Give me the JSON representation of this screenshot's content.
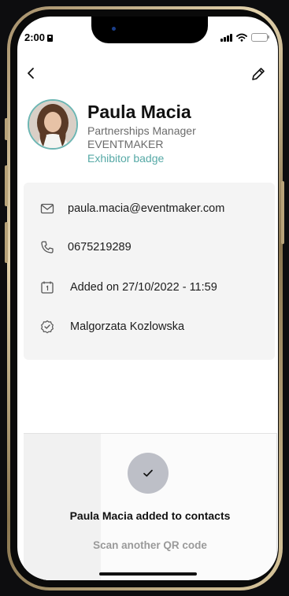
{
  "status": {
    "time": "2:00"
  },
  "header": {
    "back_icon": "chevron-left-icon",
    "edit_icon": "pencil-icon"
  },
  "contact": {
    "name": "Paula Macia",
    "role": "Partnerships Manager",
    "company": "EVENTMAKER",
    "badge": "Exhibitor badge",
    "accent_color": "#56a9a6"
  },
  "details": [
    {
      "icon": "mail-icon",
      "text": "paula.macia@eventmaker.com"
    },
    {
      "icon": "phone-icon",
      "text": "0675219289"
    },
    {
      "icon": "calendar-icon",
      "text": "Added on 27/10/2022 - 11:59"
    },
    {
      "icon": "check-badge-icon",
      "text": "Malgorzata Kozlowska"
    }
  ],
  "toast": {
    "icon": "check-icon",
    "message": "Paula Macia added to contacts",
    "secondary_action": "Scan another QR code"
  }
}
